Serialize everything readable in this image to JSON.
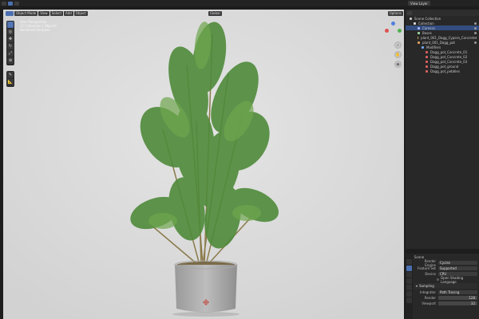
{
  "topbar": {
    "scene_label": "Scene",
    "view_layer_label": "View Layer"
  },
  "viewport": {
    "mode": "Object Mode",
    "menus": [
      "View",
      "Select",
      "Add",
      "Object"
    ],
    "transform": "Global",
    "options": "Options",
    "overlay_lines": [
      "User Perspective",
      "(1) Collection | Objects",
      "Rendered Samples"
    ]
  },
  "outliner": {
    "search_placeholder": "",
    "rows": [
      {
        "label": "Scene Collection",
        "indent": 1,
        "color": "#c8c8c8"
      },
      {
        "label": "Collection",
        "indent": 2,
        "color": "#d9d9d9"
      },
      {
        "label": "Camera",
        "indent": 3,
        "color": "#a8b8ff",
        "selected": true
      },
      {
        "label": "Bases",
        "indent": 3,
        "color": "#9ad69a"
      },
      {
        "label": "plant_001_Dagg_Cypera_Concrete",
        "indent": 3,
        "color": "#e0a060"
      },
      {
        "label": "plant_001_Dagg_pot",
        "indent": 3,
        "color": "#e0a060"
      },
      {
        "label": "Modifiers",
        "indent": 4,
        "color": "#70a8ff"
      },
      {
        "label": "Dagg_pot_Concrete_01",
        "indent": 5,
        "color": "#e06060"
      },
      {
        "label": "Dagg_pot_Concrete_02",
        "indent": 5,
        "color": "#e06060"
      },
      {
        "label": "Dagg_pot_Concrete_03",
        "indent": 5,
        "color": "#e06060"
      },
      {
        "label": "Dagg_pot_ground",
        "indent": 5,
        "color": "#e06060"
      },
      {
        "label": "Dagg_pot_pebbles",
        "indent": 5,
        "color": "#e06060"
      }
    ]
  },
  "properties": {
    "title": "Scene",
    "render_engine_label": "Render Engine",
    "render_engine": "Cycles",
    "feature_set_label": "Feature Set",
    "feature_set": "Supported",
    "device_label": "Device",
    "device": "CPU",
    "osl_label": "Open Shading Language",
    "sampling_label": "Sampling",
    "integrator_label": "Integrator",
    "integrator": "Path Tracing",
    "render_label": "Render",
    "render_value": "128",
    "viewport_label": "Viewport",
    "viewport_value": "32"
  }
}
